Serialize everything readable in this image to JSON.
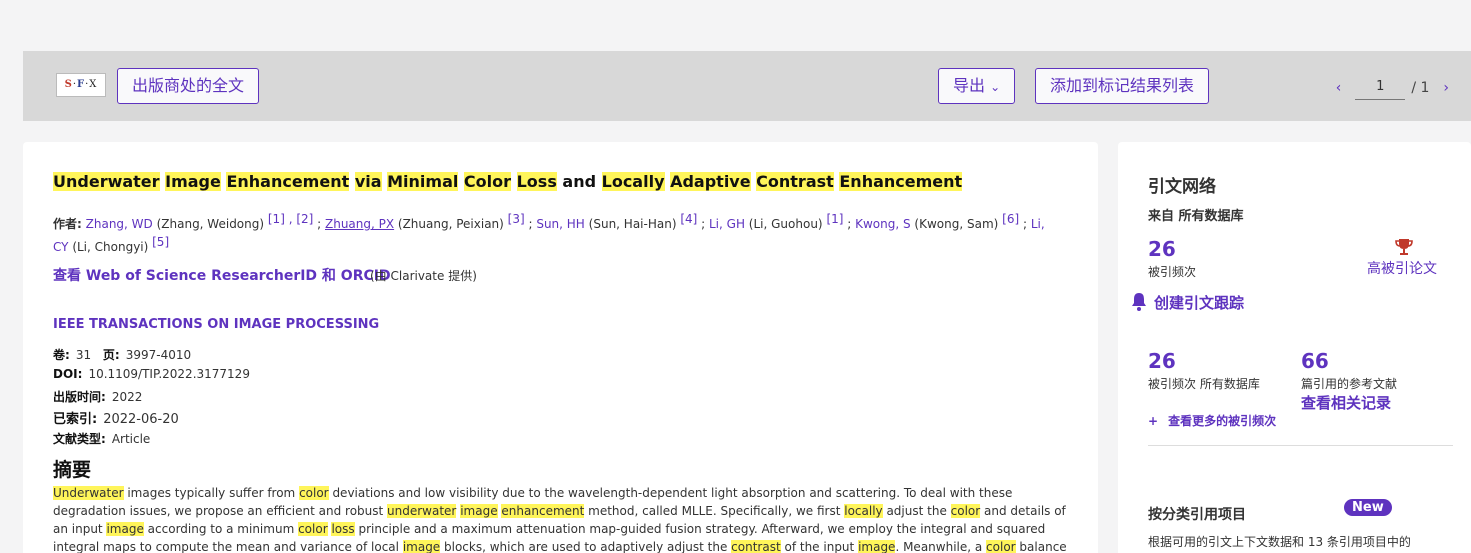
{
  "toolbar": {
    "sfx_s": "S",
    "sfx_f": "F",
    "sfx_x": "X",
    "fulltext_label": "出版商处的全文",
    "export_label": "导出",
    "add_marked_label": "添加到标记结果列表",
    "page_current": "1",
    "page_total": "/ 1"
  },
  "record": {
    "title_parts": [
      {
        "text": "Underwater",
        "hl": true
      },
      {
        "text": " ",
        "hl": false
      },
      {
        "text": "Image",
        "hl": true
      },
      {
        "text": " ",
        "hl": false
      },
      {
        "text": "Enhancement",
        "hl": true
      },
      {
        "text": " ",
        "hl": false
      },
      {
        "text": "via",
        "hl": true
      },
      {
        "text": " ",
        "hl": false
      },
      {
        "text": "Minimal",
        "hl": true
      },
      {
        "text": " ",
        "hl": false
      },
      {
        "text": "Color",
        "hl": true
      },
      {
        "text": " ",
        "hl": false
      },
      {
        "text": "Loss",
        "hl": true
      },
      {
        "text": " and ",
        "hl": false
      },
      {
        "text": "Locally",
        "hl": true
      },
      {
        "text": " ",
        "hl": false
      },
      {
        "text": "Adaptive",
        "hl": true
      },
      {
        "text": " ",
        "hl": false
      },
      {
        "text": "Contrast",
        "hl": true
      },
      {
        "text": " ",
        "hl": false
      },
      {
        "text": "Enhancement",
        "hl": true
      }
    ],
    "authors_label": "作者:",
    "authors": [
      {
        "short": "Zhang, WD",
        "full": " (Zhang, Weidong) ",
        "sup": "[1] , [2]",
        "sep": " ; "
      },
      {
        "short": "Zhuang, PX",
        "full": " (Zhuang, Peixian) ",
        "sup": "[3]",
        "sep": " ; "
      },
      {
        "short": "Sun, HH",
        "full": " (Sun, Hai-Han) ",
        "sup": "[4]",
        "sep": " ; "
      },
      {
        "short": "Li, GH",
        "full": " (Li, Guohou) ",
        "sup": "[1]",
        "sep": " ; "
      },
      {
        "short": "Kwong, S",
        "full": " (Kwong, Sam) ",
        "sup": "[6]",
        "sep": " ; "
      },
      {
        "short": "Li, CY",
        "full": " (Li, Chongyi) ",
        "sup": "[5]",
        "sep": ""
      }
    ],
    "researcher_link": "查看 Web of Science ResearcherID 和 ORCID",
    "researcher_note": "(由 Clarivate 提供)",
    "journal": "IEEE TRANSACTIONS ON IMAGE PROCESSING",
    "volume_label": "卷:",
    "volume": "31",
    "pages_label": "页:",
    "pages": "3997-4010",
    "doi_label": "DOI:",
    "doi": "10.1109/TIP.2022.3177129",
    "pubdate_label": "出版时间:",
    "pubdate": "2022",
    "indexed_label": "已索引:",
    "indexed": "2022-06-20",
    "doctype_label": "文献类型:",
    "doctype": "Article",
    "abstract_heading": "摘要",
    "abstract_parts": [
      {
        "text": "Underwater",
        "hl": true
      },
      {
        "text": " images typically suffer from ",
        "hl": false
      },
      {
        "text": "color",
        "hl": true
      },
      {
        "text": " deviations and low visibility due to the wavelength-dependent light absorption and scattering. To deal with these degradation issues, we propose an efficient and robust ",
        "hl": false
      },
      {
        "text": "underwater",
        "hl": true
      },
      {
        "text": " ",
        "hl": false
      },
      {
        "text": "image",
        "hl": true
      },
      {
        "text": " ",
        "hl": false
      },
      {
        "text": "enhancement",
        "hl": true
      },
      {
        "text": " method, called MLLE. Specifically, we first ",
        "hl": false
      },
      {
        "text": "locally",
        "hl": true
      },
      {
        "text": " adjust the ",
        "hl": false
      },
      {
        "text": "color",
        "hl": true
      },
      {
        "text": " and details of an input ",
        "hl": false
      },
      {
        "text": "image",
        "hl": true
      },
      {
        "text": " according to a minimum ",
        "hl": false
      },
      {
        "text": "color",
        "hl": true
      },
      {
        "text": " ",
        "hl": false
      },
      {
        "text": "loss",
        "hl": true
      },
      {
        "text": " principle and a maximum attenuation map-guided fusion strategy. Afterward, we employ the integral and squared integral maps to compute the mean and variance of local ",
        "hl": false
      },
      {
        "text": "image",
        "hl": true
      },
      {
        "text": " blocks, which are used to adaptively adjust the ",
        "hl": false
      },
      {
        "text": "contrast",
        "hl": true
      },
      {
        "text": " of the input ",
        "hl": false
      },
      {
        "text": "image",
        "hl": true
      },
      {
        "text": ". Meanwhile, a ",
        "hl": false
      },
      {
        "text": "color",
        "hl": true
      },
      {
        "text": " balance strategy is introduced to",
        "hl": false
      }
    ]
  },
  "citation": {
    "title": "引文网络",
    "source": "来自 所有数据库",
    "cited_count": "26",
    "cited_label": "被引频次",
    "highly_cited": "高被引论文",
    "create_alert": "创建引文跟踪",
    "all_db_count": "26",
    "all_db_label": "被引频次 所有数据库",
    "refs_count": "66",
    "refs_label": "篇引用的参考文献",
    "related_link": "查看相关记录",
    "more_link": "查看更多的被引频次",
    "classify_title": "按分类引用项目",
    "new_badge": "New",
    "classify_desc": "根据可用的引文上下文数据和 13 条引用项目中的"
  },
  "colors": {
    "accent": "#5e33bf",
    "highlight": "#fff55a",
    "trophy": "#c0392b"
  }
}
